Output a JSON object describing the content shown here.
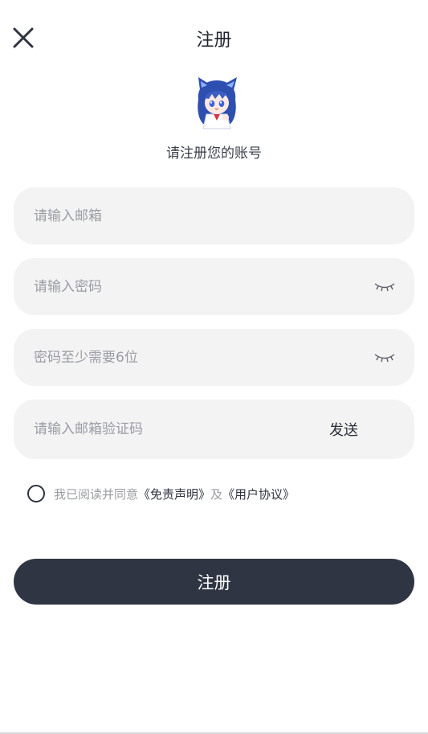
{
  "header": {
    "title": "注册"
  },
  "subtitle": "请注册您的账号",
  "form": {
    "email_placeholder": "请输入邮箱",
    "password_placeholder": "请输入密码",
    "confirm_placeholder": "密码至少需要6位",
    "code_placeholder": "请输入邮箱验证码",
    "send_label": "发送"
  },
  "agreement": {
    "prefix": "我已阅读并同意",
    "disclaimer": "《免责声明》",
    "conjunction": "及",
    "user_agreement": "《用户协议》"
  },
  "submit_label": "注册",
  "colors": {
    "primary": "#2f3542",
    "field_bg": "#f3f3f4",
    "placeholder": "#9a9ca3"
  }
}
